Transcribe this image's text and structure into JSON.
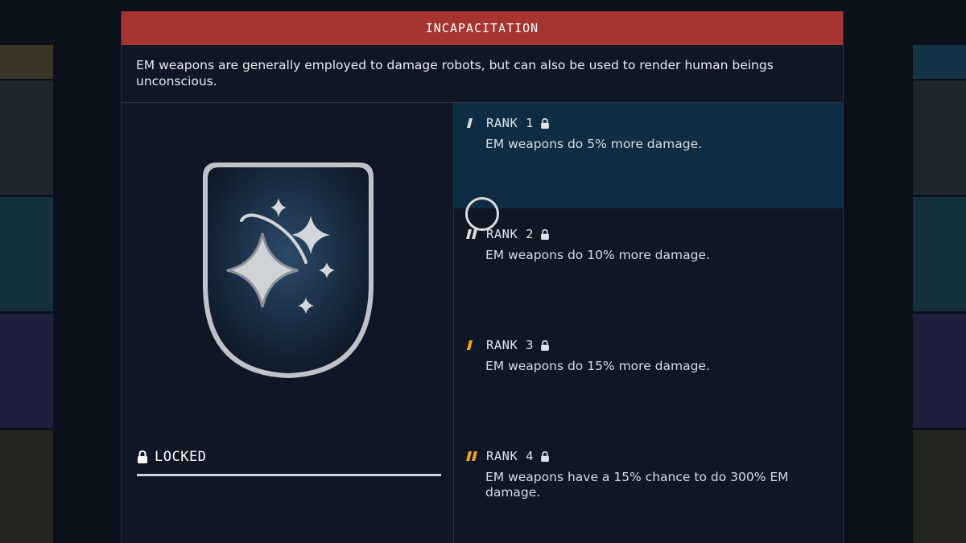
{
  "skill": {
    "title": "INCAPACITATION",
    "description": "EM weapons are generally employed to damage robots, but can also be used to render human beings unconscious.",
    "status_label": "LOCKED",
    "badge_icon": "sparkles-badge-icon"
  },
  "ranks": [
    {
      "label": "RANK 1",
      "text": "EM weapons do 5% more damage.",
      "locked": true,
      "marker_color": "#d9dde2",
      "marker_count": 1
    },
    {
      "label": "RANK 2",
      "text": "EM weapons do 10% more damage.",
      "locked": true,
      "marker_color": "#d9dde2",
      "marker_count": 2
    },
    {
      "label": "RANK 3",
      "text": "EM weapons do 15% more damage.",
      "locked": true,
      "marker_color": "#f2a516",
      "marker_count": 1
    },
    {
      "label": "RANK 4",
      "text": "EM weapons have a 15% chance to do 300% EM damage.",
      "locked": true,
      "marker_color": "#f2a516",
      "marker_count": 2
    }
  ],
  "colors": {
    "title_bar": "#a63430",
    "panel_bg": "#0f1724",
    "selected_rank_bg": "#0e2d45",
    "gold_accent": "#f2a516"
  }
}
